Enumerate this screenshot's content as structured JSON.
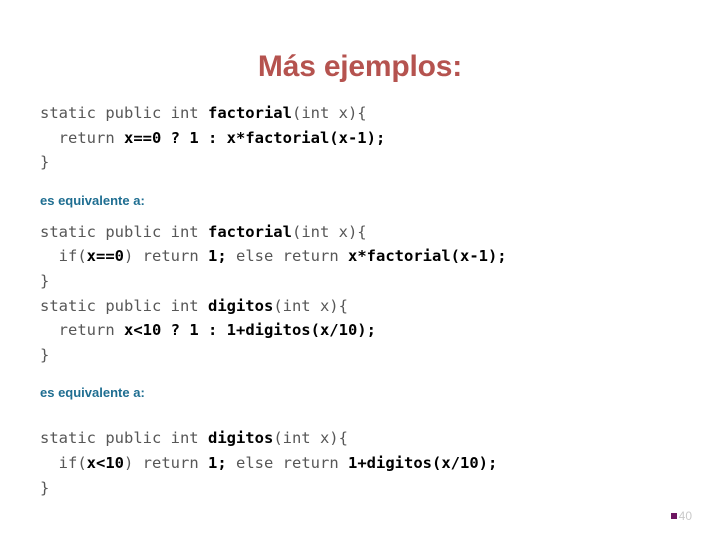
{
  "slide": {
    "title": "Más ejemplos:",
    "title_color": "#b5534f",
    "note_color": "#1f6e91",
    "code_regular_color": "#575757",
    "code_bold_color": "#000000",
    "background_color": "#ffffff"
  },
  "notes": {
    "equivalente_1": "es equivalente a:",
    "equivalente_2": "es equivalente a:"
  },
  "code_blocks": [
    {
      "id": "factorial-ternary",
      "lines": [
        [
          {
            "t": "static public int ",
            "b": false
          },
          {
            "t": "factorial",
            "b": true
          },
          {
            "t": "(int x){",
            "b": false
          }
        ],
        [
          {
            "t": "  return ",
            "b": false
          },
          {
            "t": "x==0 ? 1 : x*factorial(x-1);",
            "b": true
          }
        ],
        [
          {
            "t": "}",
            "b": false
          }
        ]
      ]
    },
    {
      "id": "factorial-and-digitos-ifelse",
      "lines": [
        [
          {
            "t": "static public int ",
            "b": false
          },
          {
            "t": "factorial",
            "b": true
          },
          {
            "t": "(int x){",
            "b": false
          }
        ],
        [
          {
            "t": "  if(",
            "b": false
          },
          {
            "t": "x==0",
            "b": true
          },
          {
            "t": ") return ",
            "b": false
          },
          {
            "t": "1;",
            "b": true
          },
          {
            "t": " else return ",
            "b": false
          },
          {
            "t": "x*factorial(x-1);",
            "b": true
          }
        ],
        [
          {
            "t": "}",
            "b": false
          }
        ],
        [
          {
            "t": "static public int ",
            "b": false
          },
          {
            "t": "digitos",
            "b": true
          },
          {
            "t": "(int x){",
            "b": false
          }
        ],
        [
          {
            "t": "  return ",
            "b": false
          },
          {
            "t": "x<10 ? 1 : 1+digitos(x/10);",
            "b": true
          }
        ],
        [
          {
            "t": "}",
            "b": false
          }
        ]
      ]
    },
    {
      "id": "digitos-ifelse",
      "lines": [
        [
          {
            "t": "static public int ",
            "b": false
          },
          {
            "t": "digitos",
            "b": true
          },
          {
            "t": "(int x){",
            "b": false
          }
        ],
        [
          {
            "t": "  if(",
            "b": false
          },
          {
            "t": "x<10",
            "b": true
          },
          {
            "t": ") return ",
            "b": false
          },
          {
            "t": "1;",
            "b": true
          },
          {
            "t": " else return ",
            "b": false
          },
          {
            "t": "1+digitos(x/10);",
            "b": true
          }
        ],
        [
          {
            "t": "}",
            "b": false
          }
        ]
      ]
    }
  ],
  "footer": {
    "page_number": "40",
    "bullet_color": "#6d1661",
    "page_number_color": "#c9c9c9"
  }
}
